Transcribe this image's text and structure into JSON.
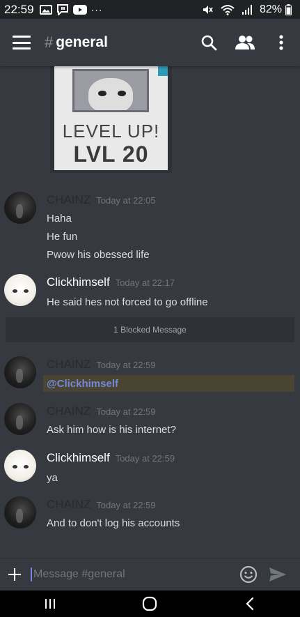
{
  "status_bar": {
    "time": "22:59",
    "battery": "82%",
    "icons": [
      "image-icon",
      "message-icon",
      "youtube-icon",
      "more-dots-icon",
      "mute-icon",
      "wifi-icon",
      "signal-icon"
    ]
  },
  "app_bar": {
    "hash": "#",
    "channel_name": "general",
    "icons": [
      "menu-icon",
      "search-icon",
      "members-icon",
      "more-vert-icon"
    ]
  },
  "level_up_image": {
    "line1": "LEVEL UP!",
    "line2": "LVL 20"
  },
  "messages": [
    {
      "author": "CHAINZ",
      "timestamp": "Today at 22:05",
      "lines": [
        "Haha",
        "He fun",
        "Pwow his obessed life"
      ],
      "avatar": "dark"
    },
    {
      "author": "Clickhimself",
      "timestamp": "Today at 22:17",
      "lines": [
        "He said hes not forced to go offline"
      ],
      "avatar": "light"
    },
    {
      "author": "CHAINZ",
      "timestamp": "Today at 22:59",
      "lines": [
        "@Clickhimself"
      ],
      "avatar": "dark",
      "mention": true
    },
    {
      "author": "CHAINZ",
      "timestamp": "Today at 22:59",
      "lines": [
        "Ask him how is his internet?"
      ],
      "avatar": "dark"
    },
    {
      "author": "Clickhimself",
      "timestamp": "Today at 22:59",
      "lines": [
        "ya"
      ],
      "avatar": "light"
    },
    {
      "author": "CHAINZ",
      "timestamp": "Today at 22:59",
      "lines": [
        "And to don't log his accounts"
      ],
      "avatar": "dark"
    }
  ],
  "blocked": {
    "text": "1 Blocked Message"
  },
  "input_bar": {
    "placeholder": "Message #general",
    "value": ""
  },
  "colors": {
    "background": "#36393f",
    "status_bar": "#202225",
    "mention_text": "#7289da",
    "mention_highlight": "#4a4433",
    "timestamp": "#72767d"
  }
}
